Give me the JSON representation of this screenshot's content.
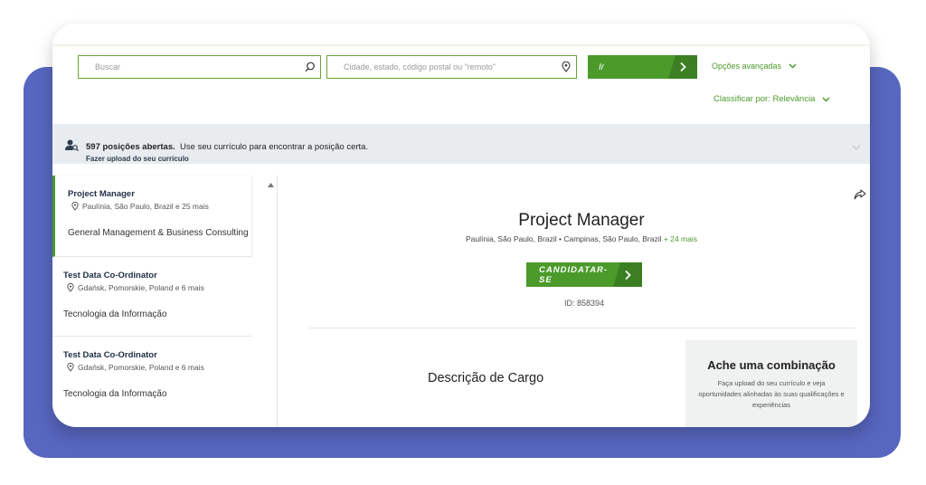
{
  "search": {
    "keyword_placeholder": "Buscar",
    "location_placeholder": "Cidade, estado, código postal ou \"remoto\"",
    "go_label": "Ir",
    "advanced_label": "Opções avançadas",
    "sort_label": "Classificar por: Relevância"
  },
  "banner": {
    "count_text": "597 posições abertas.",
    "message": "Use seu currículo para encontrar a posição certa.",
    "upload_label": "Fazer upload do seu currículo"
  },
  "jobs": [
    {
      "title": "Project Manager",
      "location": "Paulínia, São Paulo, Brazil e 25 mais",
      "category": "General Management & Business Consulting"
    },
    {
      "title": "Test Data Co-Ordinator",
      "location": "Gdańsk, Pomorskie, Poland e 6 mais",
      "category": "Tecnologia da Informação"
    },
    {
      "title": "Test Data Co-Ordinator",
      "location": "Gdańsk, Pomorskie, Poland e 6 mais",
      "category": "Tecnologia da Informação"
    }
  ],
  "detail": {
    "title": "Project Manager",
    "locations": "Paulínia, São Paulo, Brazil • Campinas, São Paulo, Brazil",
    "more_locations": "+ 24 mais",
    "apply_label": "CANDIDATAR-SE",
    "job_id": "ID: 858394",
    "description_heading": "Descrição de Cargo"
  },
  "match": {
    "heading": "Ache uma combinação",
    "text": "Faça upload do seu currículo e veja oportunidades alinhadas às suas qualificações e experiências"
  },
  "colors": {
    "accent_green": "#4b9a2a",
    "accent_green_dark": "#3b7f22",
    "background_panel": "#5766bf",
    "banner_bg": "#e8ecef"
  }
}
